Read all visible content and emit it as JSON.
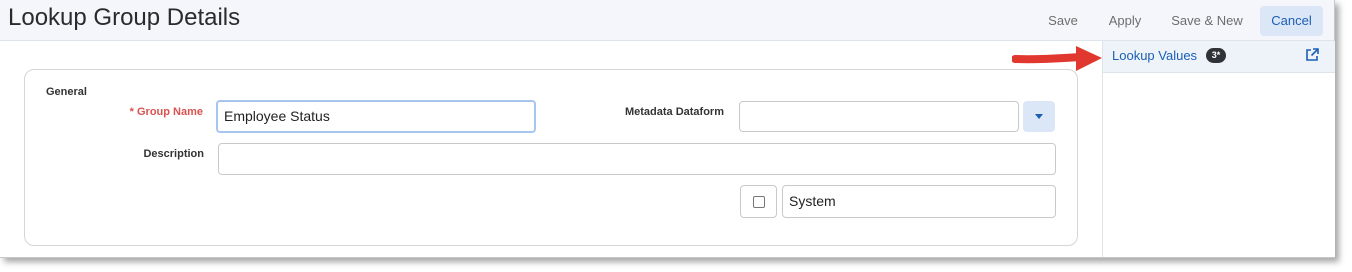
{
  "window": {
    "title": "Lookup Group Details"
  },
  "toolbar": {
    "save_label": "Save",
    "apply_label": "Apply",
    "save_new_label": "Save & New",
    "cancel_label": "Cancel"
  },
  "form": {
    "section_title": "General",
    "group_name_label": "* Group Name",
    "group_name_value": "Employee Status",
    "metadata_label": "Metadata Dataform",
    "metadata_value": "",
    "description_label": "Description",
    "description_value": "",
    "system_label": "System",
    "system_checked": false
  },
  "side_panel": {
    "link_label": "Lookup Values",
    "badge_count": "3*",
    "external_icon": "external-link-icon"
  },
  "annotation": {
    "arrow_color": "#e0382f"
  },
  "colors": {
    "accent": "#1b5fb4",
    "required": "#d9534f",
    "header_bg": "#f4f6fb",
    "primary_button_bg": "#dbe6f7"
  }
}
